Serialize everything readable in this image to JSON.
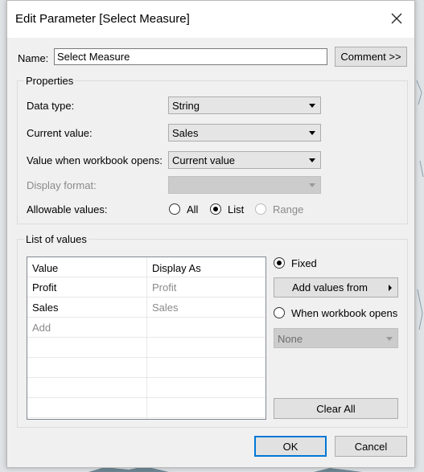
{
  "dialog": {
    "title": "Edit Parameter [Select Measure]",
    "close_icon": "close-icon"
  },
  "name_row": {
    "label": "Name:",
    "value": "Select Measure",
    "comment_button": "Comment >>"
  },
  "properties": {
    "group_label": "Properties",
    "data_type_label": "Data type:",
    "data_type_value": "String",
    "current_value_label": "Current value:",
    "current_value_value": "Sales",
    "workbook_opens_label": "Value when workbook opens:",
    "workbook_opens_value": "Current value",
    "display_format_label": "Display format:",
    "display_format_value": "",
    "allowable_values_label": "Allowable values:",
    "allowable_options": [
      "All",
      "List",
      "Range"
    ],
    "allowable_selected": "List"
  },
  "list_of_values": {
    "group_label": "List of values",
    "columns": [
      "Value",
      "Display As"
    ],
    "rows": [
      {
        "value": "Profit",
        "display": "Profit"
      },
      {
        "value": "Sales",
        "display": "Sales"
      }
    ],
    "add_placeholder": "Add",
    "fixed_label": "Fixed",
    "add_values_from": "Add values from",
    "when_workbook_opens_label": "When workbook opens",
    "workbook_opens_combo_value": "None",
    "clear_all": "Clear All"
  },
  "footer": {
    "ok": "OK",
    "cancel": "Cancel"
  },
  "colors": {
    "dialog_bg": "#f0f0f0",
    "title_bg": "#ffffff",
    "focus_border": "#0078d7",
    "button_bg": "#e1e1e1"
  }
}
